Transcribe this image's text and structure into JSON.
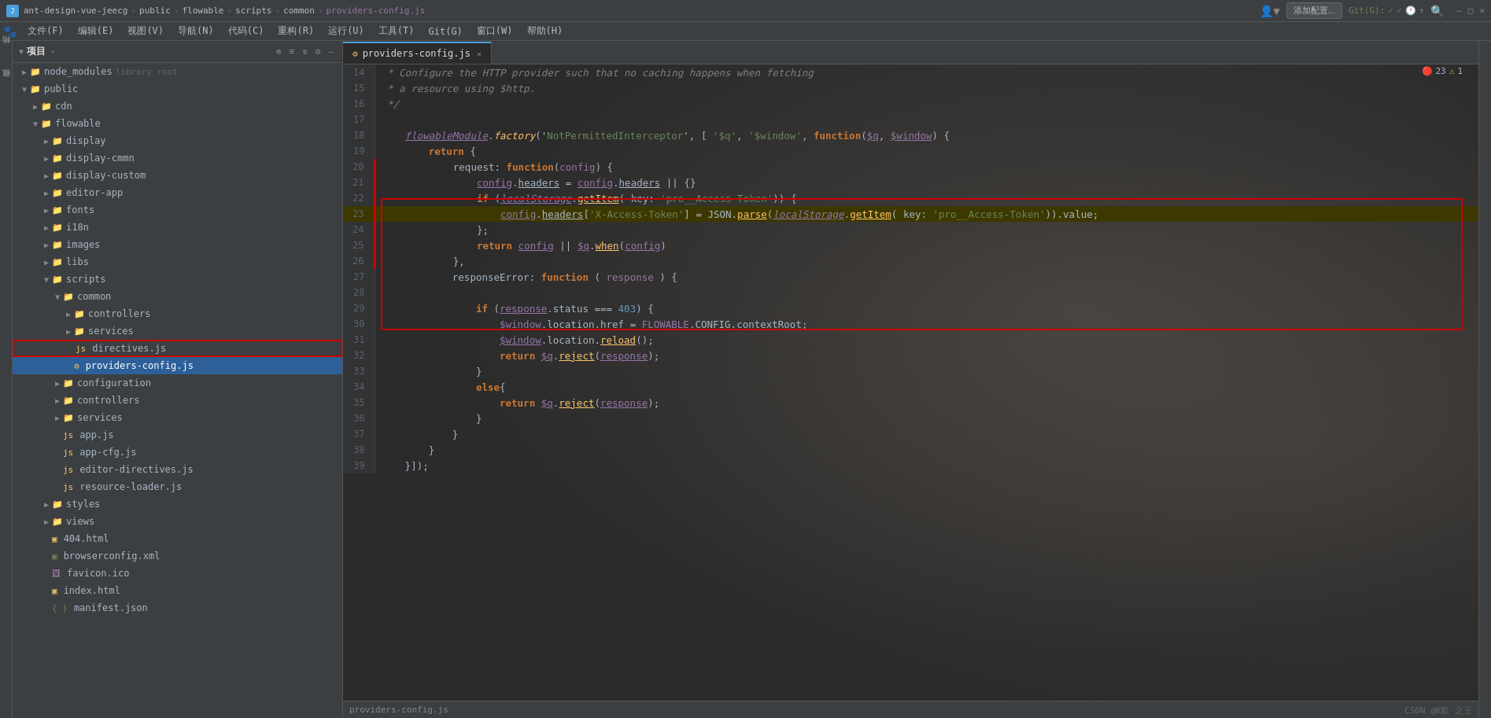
{
  "titleBar": {
    "appName": "ant-design-vue-jeecg",
    "breadcrumb": [
      "public",
      "flowable",
      "scripts",
      "common",
      "providers-config.js"
    ],
    "activeFile": "providers-config.js",
    "addConfigLabel": "添加配置...",
    "gitLabel": "Git(G):",
    "searchIcon": "🔍",
    "winMin": "—",
    "winMax": "□",
    "winClose": "✕"
  },
  "menuBar": {
    "items": [
      "文件(F)",
      "编辑(E)",
      "视图(V)",
      "导航(N)",
      "代码(C)",
      "重构(R)",
      "运行(U)",
      "工具(T)",
      "Git(G)",
      "窗口(W)",
      "帮助(H)"
    ]
  },
  "fileTree": {
    "header": "项目",
    "items": [
      {
        "id": "node_modules",
        "label": "node_modules",
        "type": "folder",
        "depth": 0,
        "expanded": false,
        "extra": "library root"
      },
      {
        "id": "public",
        "label": "public",
        "type": "folder",
        "depth": 0,
        "expanded": true
      },
      {
        "id": "cdn",
        "label": "cdn",
        "type": "folder",
        "depth": 1,
        "expanded": false
      },
      {
        "id": "flowable",
        "label": "flowable",
        "type": "folder",
        "depth": 1,
        "expanded": true
      },
      {
        "id": "display",
        "label": "display",
        "type": "folder",
        "depth": 2,
        "expanded": false
      },
      {
        "id": "display-cmmn",
        "label": "display-cmmn",
        "type": "folder",
        "depth": 2,
        "expanded": false
      },
      {
        "id": "display-custom",
        "label": "display-custom",
        "type": "folder",
        "depth": 2,
        "expanded": false
      },
      {
        "id": "editor-app",
        "label": "editor-app",
        "type": "folder",
        "depth": 2,
        "expanded": false
      },
      {
        "id": "fonts",
        "label": "fonts",
        "type": "folder",
        "depth": 2,
        "expanded": false
      },
      {
        "id": "i18n",
        "label": "i18n",
        "type": "folder",
        "depth": 2,
        "expanded": false
      },
      {
        "id": "images",
        "label": "images",
        "type": "folder",
        "depth": 2,
        "expanded": false
      },
      {
        "id": "libs",
        "label": "libs",
        "type": "folder",
        "depth": 2,
        "expanded": false
      },
      {
        "id": "scripts",
        "label": "scripts",
        "type": "folder",
        "depth": 2,
        "expanded": true
      },
      {
        "id": "common",
        "label": "common",
        "type": "folder",
        "depth": 3,
        "expanded": true
      },
      {
        "id": "controllers",
        "label": "controllers",
        "type": "folder",
        "depth": 4,
        "expanded": false
      },
      {
        "id": "services",
        "label": "services",
        "type": "folder",
        "depth": 4,
        "expanded": false
      },
      {
        "id": "directives.js",
        "label": "directives.js",
        "type": "js",
        "depth": 4,
        "highlighted": true
      },
      {
        "id": "providers-config.js",
        "label": "providers-config.js",
        "type": "js",
        "depth": 4,
        "selected": true
      },
      {
        "id": "configuration",
        "label": "configuration",
        "type": "folder",
        "depth": 3,
        "expanded": false
      },
      {
        "id": "controllers2",
        "label": "controllers",
        "type": "folder",
        "depth": 3,
        "expanded": false
      },
      {
        "id": "services2",
        "label": "services",
        "type": "folder",
        "depth": 3,
        "expanded": false
      },
      {
        "id": "app.js",
        "label": "app.js",
        "type": "js",
        "depth": 3
      },
      {
        "id": "app-cfg.js",
        "label": "app-cfg.js",
        "type": "js",
        "depth": 3
      },
      {
        "id": "editor-directives.js",
        "label": "editor-directives.js",
        "type": "js",
        "depth": 3
      },
      {
        "id": "resource-loader.js",
        "label": "resource-loader.js",
        "type": "js",
        "depth": 3
      },
      {
        "id": "styles",
        "label": "styles",
        "type": "folder",
        "depth": 2,
        "expanded": false
      },
      {
        "id": "views",
        "label": "views",
        "type": "folder",
        "depth": 2,
        "expanded": false
      },
      {
        "id": "404.html",
        "label": "404.html",
        "type": "html",
        "depth": 2
      },
      {
        "id": "browserconfig.xml",
        "label": "browserconfig.xml",
        "type": "xml",
        "depth": 2
      },
      {
        "id": "favicon.ico",
        "label": "favicon.ico",
        "type": "img",
        "depth": 2
      },
      {
        "id": "index.html",
        "label": "index.html",
        "type": "html",
        "depth": 2
      },
      {
        "id": "manifest.json",
        "label": "manifest.json",
        "type": "json",
        "depth": 2
      }
    ]
  },
  "editor": {
    "filename": "providers-config.js",
    "errorCount": "23",
    "warnCount": "1",
    "lines": [
      {
        "num": 14,
        "content": "comment_star"
      },
      {
        "num": 15,
        "content": "comment_resource"
      },
      {
        "num": 16,
        "content": "comment_end"
      },
      {
        "num": 17,
        "content": "blank"
      },
      {
        "num": 18,
        "content": "flowable_factory"
      },
      {
        "num": 19,
        "content": "return_open"
      },
      {
        "num": 20,
        "content": "request_fn"
      },
      {
        "num": 21,
        "content": "config_headers"
      },
      {
        "num": 22,
        "content": "if_localstorage"
      },
      {
        "num": 23,
        "content": "config_headers_set",
        "highlight": true
      },
      {
        "num": 24,
        "content": "close_brace_semi"
      },
      {
        "num": 25,
        "content": "return_config"
      },
      {
        "num": 26,
        "content": "close_brace_comma"
      },
      {
        "num": 27,
        "content": "responseError_fn"
      },
      {
        "num": 28,
        "content": "blank2"
      },
      {
        "num": 29,
        "content": "if_response_status"
      },
      {
        "num": 30,
        "content": "window_location_href"
      },
      {
        "num": 31,
        "content": "window_location_reload"
      },
      {
        "num": 32,
        "content": "return_q_reject"
      },
      {
        "num": 33,
        "content": "close_brace"
      },
      {
        "num": 34,
        "content": "else_open"
      },
      {
        "num": 35,
        "content": "return_q_reject2"
      },
      {
        "num": 36,
        "content": "close_brace2"
      },
      {
        "num": 37,
        "content": "close_brace3"
      },
      {
        "num": 38,
        "content": "close_bracket"
      },
      {
        "num": 39,
        "content": "close_all"
      }
    ]
  },
  "statusBar": {
    "csdn": "CSDN @K歌 之王"
  }
}
